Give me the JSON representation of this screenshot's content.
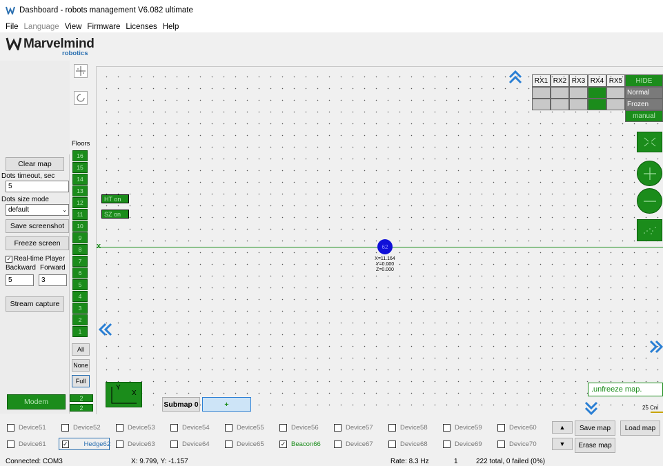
{
  "window": {
    "title": "Dashboard - robots management  V6.082  ultimate"
  },
  "menu": [
    {
      "label": "File",
      "enabled": true
    },
    {
      "label": "Language",
      "enabled": false
    },
    {
      "label": "View",
      "enabled": true
    },
    {
      "label": "Firmware",
      "enabled": true
    },
    {
      "label": "Licenses",
      "enabled": true
    },
    {
      "label": "Help",
      "enabled": true
    }
  ],
  "brand": {
    "name": "Marvelmind",
    "sub": "robotics"
  },
  "left_panel": {
    "clear_map": "Clear map",
    "dots_timeout_label": "Dots timeout, sec",
    "dots_timeout_value": "5",
    "dots_size_label": "Dots size mode",
    "dots_size_value": "default",
    "save_screenshot": "Save screenshot",
    "freeze_screen": "Freeze screen",
    "realtime_player": "Real-time Player",
    "backward_label": "Backward",
    "forward_label": "Forward",
    "backward_value": "5",
    "forward_value": "3",
    "stream_capture": "Stream capture",
    "modem": "Modem",
    "modem_num_1": "2",
    "modem_num_2": "2"
  },
  "floors": {
    "label": "Floors",
    "items": [
      "16",
      "15",
      "14",
      "13",
      "12",
      "11",
      "10",
      "9",
      "8",
      "7",
      "6",
      "5",
      "4",
      "3",
      "2",
      "1"
    ],
    "all": "All",
    "none": "None",
    "full": "Full"
  },
  "map": {
    "ht_on": "HT on",
    "sz_on": "SZ on",
    "axis_x_marker": "x",
    "beacon_label": "62",
    "beacon_coords": {
      "x": "X=11.164",
      "y": "Y=0.000",
      "z": "Z=0.000"
    },
    "axes_icon_y": "Y",
    "axes_icon_x": "X",
    "submap": "Submap 0",
    "add_submap": "+",
    "unfreeze": ".unfreeze map.",
    "scale": "25 Cm"
  },
  "rx": {
    "headers": [
      "RX1",
      "RX2",
      "RX3",
      "RX4",
      "RX5"
    ],
    "hide": "HIDE",
    "normal": "Normal",
    "frozen": "Frozen",
    "manual": "manual"
  },
  "devices_row1": [
    {
      "label": "Device51",
      "checked": false
    },
    {
      "label": "Device52",
      "checked": false
    },
    {
      "label": "Device53",
      "checked": false
    },
    {
      "label": "Device54",
      "checked": false
    },
    {
      "label": "Device55",
      "checked": false
    },
    {
      "label": "Device56",
      "checked": false
    },
    {
      "label": "Device57",
      "checked": false
    },
    {
      "label": "Device58",
      "checked": false
    },
    {
      "label": "Device59",
      "checked": false
    },
    {
      "label": "Device60",
      "checked": false
    }
  ],
  "devices_row2": [
    {
      "label": "Device61",
      "checked": false
    },
    {
      "label": "Hedge62",
      "checked": true
    },
    {
      "label": "Device63",
      "checked": false
    },
    {
      "label": "Device64",
      "checked": false
    },
    {
      "label": "Device65",
      "checked": false
    },
    {
      "label": "Beacon66",
      "checked": true
    },
    {
      "label": "Device67",
      "checked": false
    },
    {
      "label": "Device68",
      "checked": false
    },
    {
      "label": "Device69",
      "checked": false
    },
    {
      "label": "Device70",
      "checked": false
    }
  ],
  "buttons": {
    "save_map": "Save map",
    "load_map": "Load map",
    "erase_map": "Erase map"
  },
  "status": {
    "connected": "Connected: COM3",
    "coords": "X: 9.799, Y: -1.157",
    "rate": "Rate: 8.3 Hz",
    "count": "1",
    "total": "222 total, 0 failed (0%)"
  },
  "colors": {
    "green": "#1b8c1b",
    "beacon_blue": "#1010d8",
    "selected_blue": "#2a6fb0",
    "arrow_blue": "#2a7fd4"
  }
}
